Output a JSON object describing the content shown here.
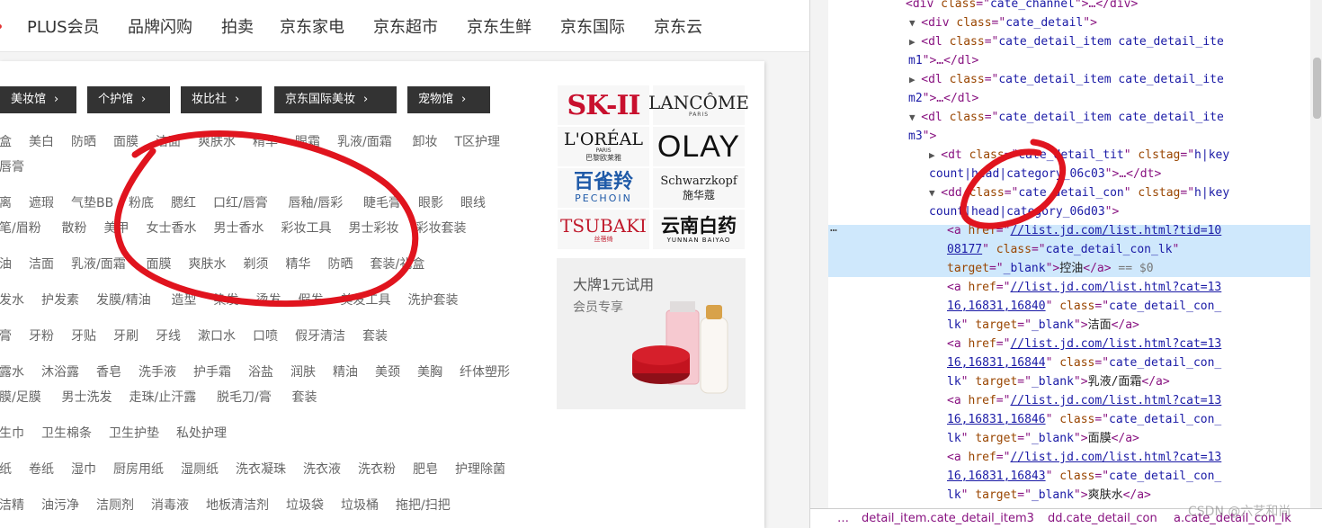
{
  "topnav": {
    "items": [
      "PLUS会员",
      "品牌闪购",
      "拍卖",
      "京东家电",
      "京东超市",
      "京东生鲜",
      "京东国际",
      "京东云"
    ]
  },
  "channels": [
    "美妆馆",
    "个护馆",
    "妆比社",
    "京东国际美妆",
    "宠物馆"
  ],
  "categories": [
    [
      "盒",
      "美白",
      "防晒",
      "面膜",
      "洁面",
      "爽肤水",
      "精华",
      "眼霜",
      "乳液/面霜",
      "卸妆",
      "T区护理"
    ],
    [
      "唇膏"
    ],
    [
      "离",
      "遮瑕",
      "气垫BB",
      "粉底",
      "腮红",
      "口红/唇膏",
      "唇釉/唇彩",
      "睫毛膏",
      "眼影",
      "眼线"
    ],
    [
      "笔/眉粉",
      "散粉",
      "美甲",
      "女士香水",
      "男士香水",
      "彩妆工具",
      "男士彩妆",
      "彩妆套装"
    ],
    [
      "油",
      "洁面",
      "乳液/面霜",
      "面膜",
      "爽肤水",
      "剃须",
      "精华",
      "防晒",
      "套装/礼盒"
    ],
    [
      "发水",
      "护发素",
      "发膜/精油",
      "造型",
      "染发",
      "烫发",
      "假发",
      "美发工具",
      "洗护套装"
    ],
    [
      "膏",
      "牙粉",
      "牙贴",
      "牙刷",
      "牙线",
      "漱口水",
      "口喷",
      "假牙清洁",
      "套装"
    ],
    [
      "露水",
      "沐浴露",
      "香皂",
      "洗手液",
      "护手霜",
      "浴盐",
      "润肤",
      "精油",
      "美颈",
      "美胸",
      "纤体塑形"
    ],
    [
      "膜/足膜",
      "男士洗发",
      "走珠/止汗露",
      "脱毛刀/膏",
      "套装"
    ],
    [
      "生巾",
      "卫生棉条",
      "卫生护垫",
      "私处护理"
    ],
    [
      "纸",
      "卷纸",
      "湿巾",
      "厨房用纸",
      "湿厕纸",
      "洗衣凝珠",
      "洗衣液",
      "洗衣粉",
      "肥皂",
      "护理除菌"
    ],
    [
      "洁精",
      "油污净",
      "洁厕剂",
      "消毒液",
      "地板清洁剂",
      "垃圾袋",
      "垃圾桶",
      "拖把/扫把"
    ]
  ],
  "brands": {
    "skii": "SK-II",
    "lancome": "LANCÔME",
    "lancome_sub": "PARIS",
    "loreal": "L'ORÉAL",
    "loreal_sub": "PARIS",
    "loreal_cn": "巴黎欧莱雅",
    "olay": "OLAY",
    "pechoin_cn": "百雀羚",
    "pechoin": "PECHOIN",
    "schwarzkopf": "Schwarzkopf",
    "schwarzkopf_cn": "施华蔻",
    "tsubaki": "TSUBAKI",
    "tsubaki_cn": "丝蓓绮",
    "yunnan_cn": "云南白药",
    "yunnan": "YUNNAN BAIYAO"
  },
  "promo": {
    "title": "大牌1元试用",
    "subtitle": "会员专享"
  },
  "devtools": {
    "lines": [
      {
        "indent": 0,
        "parts": [
          [
            "tag",
            "<div "
          ],
          [
            "attr",
            "class"
          ],
          [
            "tag",
            "=\""
          ],
          [
            "val",
            "cate_channel"
          ],
          [
            "tag",
            "\">…</div>"
          ]
        ]
      },
      {
        "indent": 0,
        "tri": "▼",
        "parts": [
          [
            "tag",
            "<div "
          ],
          [
            "attr",
            "class"
          ],
          [
            "tag",
            "=\""
          ],
          [
            "val",
            "cate_detail"
          ],
          [
            "tag",
            "\">"
          ]
        ]
      },
      {
        "indent": 1,
        "tri": "▶",
        "parts": [
          [
            "tag",
            "<dl "
          ],
          [
            "attr",
            "class"
          ],
          [
            "tag",
            "=\""
          ],
          [
            "val",
            "cate_detail_item cate_detail_ite"
          ]
        ]
      },
      {
        "indent": 1,
        "parts": [
          [
            "val",
            "m1"
          ],
          [
            "tag",
            "\">…</dl>"
          ]
        ]
      },
      {
        "indent": 1,
        "tri": "▶",
        "parts": [
          [
            "tag",
            "<dl "
          ],
          [
            "attr",
            "class"
          ],
          [
            "tag",
            "=\""
          ],
          [
            "val",
            "cate_detail_item cate_detail_ite"
          ]
        ]
      },
      {
        "indent": 1,
        "parts": [
          [
            "val",
            "m2"
          ],
          [
            "tag",
            "\">…</dl>"
          ]
        ]
      },
      {
        "indent": 1,
        "tri": "▼",
        "parts": [
          [
            "tag",
            "<dl "
          ],
          [
            "attr",
            "class"
          ],
          [
            "tag",
            "=\""
          ],
          [
            "val",
            "cate_detail_item cate_detail_ite"
          ]
        ]
      },
      {
        "indent": 1,
        "parts": [
          [
            "val",
            "m3"
          ],
          [
            "tag",
            "\">"
          ]
        ]
      },
      {
        "indent": 2,
        "tri": "▶",
        "parts": [
          [
            "tag",
            "<dt "
          ],
          [
            "attr",
            "class"
          ],
          [
            "tag",
            "=\""
          ],
          [
            "val",
            "cate_detail_tit"
          ],
          [
            "tag",
            "\" "
          ],
          [
            "attr",
            "clstag"
          ],
          [
            "tag",
            "=\""
          ],
          [
            "val",
            "h|key"
          ]
        ]
      },
      {
        "indent": 2,
        "parts": [
          [
            "val",
            "count|head|category_06c03"
          ],
          [
            "tag",
            "\">…</dt>"
          ]
        ]
      },
      {
        "indent": 2,
        "tri": "▼",
        "parts": [
          [
            "tag",
            "<dd "
          ],
          [
            "attr",
            "class"
          ],
          [
            "tag",
            "=\""
          ],
          [
            "val",
            "cate_detail_con"
          ],
          [
            "tag",
            "\" "
          ],
          [
            "attr",
            "clstag"
          ],
          [
            "tag",
            "=\""
          ],
          [
            "val",
            "h|key"
          ]
        ]
      },
      {
        "indent": 2,
        "parts": [
          [
            "val",
            "count|head|category_06d03"
          ],
          [
            "tag",
            "\">"
          ]
        ]
      },
      {
        "indent": 3,
        "parts": [
          [
            "tag",
            "<a "
          ],
          [
            "attr",
            "href"
          ],
          [
            "tag",
            "=\""
          ],
          [
            "link",
            "//list.jd.com/list.html?tid=10"
          ]
        ]
      },
      {
        "indent": 3,
        "parts": [
          [
            "link",
            "08177"
          ],
          [
            "tag",
            "\" "
          ],
          [
            "attr",
            "class"
          ],
          [
            "tag",
            "=\""
          ],
          [
            "val",
            "cate_detail_con_lk"
          ],
          [
            "tag",
            "\""
          ]
        ]
      },
      {
        "indent": 3,
        "parts": [
          [
            "attr",
            "target"
          ],
          [
            "tag",
            "=\""
          ],
          [
            "val",
            "_blank"
          ],
          [
            "tag",
            "\">"
          ],
          [
            "txt",
            "控油"
          ],
          [
            "tag",
            "</a>"
          ],
          [
            "grey",
            " == $0"
          ]
        ]
      },
      {
        "indent": 3,
        "parts": [
          [
            "tag",
            "<a "
          ],
          [
            "attr",
            "href"
          ],
          [
            "tag",
            "=\""
          ],
          [
            "link",
            "//list.jd.com/list.html?cat=13"
          ]
        ]
      },
      {
        "indent": 3,
        "parts": [
          [
            "link",
            "16,16831,16840"
          ],
          [
            "tag",
            "\" "
          ],
          [
            "attr",
            "class"
          ],
          [
            "tag",
            "=\""
          ],
          [
            "val",
            "cate_detail_con_"
          ]
        ]
      },
      {
        "indent": 3,
        "parts": [
          [
            "val",
            "lk"
          ],
          [
            "tag",
            "\" "
          ],
          [
            "attr",
            "target"
          ],
          [
            "tag",
            "=\""
          ],
          [
            "val",
            "_blank"
          ],
          [
            "tag",
            "\">"
          ],
          [
            "txt",
            "洁面"
          ],
          [
            "tag",
            "</a>"
          ]
        ]
      },
      {
        "indent": 3,
        "parts": [
          [
            "tag",
            "<a "
          ],
          [
            "attr",
            "href"
          ],
          [
            "tag",
            "=\""
          ],
          [
            "link",
            "//list.jd.com/list.html?cat=13"
          ]
        ]
      },
      {
        "indent": 3,
        "parts": [
          [
            "link",
            "16,16831,16844"
          ],
          [
            "tag",
            "\" "
          ],
          [
            "attr",
            "class"
          ],
          [
            "tag",
            "=\""
          ],
          [
            "val",
            "cate_detail_con_"
          ]
        ]
      },
      {
        "indent": 3,
        "parts": [
          [
            "val",
            "lk"
          ],
          [
            "tag",
            "\" "
          ],
          [
            "attr",
            "target"
          ],
          [
            "tag",
            "=\""
          ],
          [
            "val",
            "_blank"
          ],
          [
            "tag",
            "\">"
          ],
          [
            "txt",
            "乳液/面霜"
          ],
          [
            "tag",
            "</a>"
          ]
        ]
      },
      {
        "indent": 3,
        "parts": [
          [
            "tag",
            "<a "
          ],
          [
            "attr",
            "href"
          ],
          [
            "tag",
            "=\""
          ],
          [
            "link",
            "//list.jd.com/list.html?cat=13"
          ]
        ]
      },
      {
        "indent": 3,
        "parts": [
          [
            "link",
            "16,16831,16846"
          ],
          [
            "tag",
            "\" "
          ],
          [
            "attr",
            "class"
          ],
          [
            "tag",
            "=\""
          ],
          [
            "val",
            "cate_detail_con_"
          ]
        ]
      },
      {
        "indent": 3,
        "parts": [
          [
            "val",
            "lk"
          ],
          [
            "tag",
            "\" "
          ],
          [
            "attr",
            "target"
          ],
          [
            "tag",
            "=\""
          ],
          [
            "val",
            "_blank"
          ],
          [
            "tag",
            "\">"
          ],
          [
            "txt",
            "面膜"
          ],
          [
            "tag",
            "</a>"
          ]
        ]
      },
      {
        "indent": 3,
        "parts": [
          [
            "tag",
            "<a "
          ],
          [
            "attr",
            "href"
          ],
          [
            "tag",
            "=\""
          ],
          [
            "link",
            "//list.jd.com/list.html?cat=13"
          ]
        ]
      },
      {
        "indent": 3,
        "parts": [
          [
            "link",
            "16,16831,16843"
          ],
          [
            "tag",
            "\" "
          ],
          [
            "attr",
            "class"
          ],
          [
            "tag",
            "=\""
          ],
          [
            "val",
            "cate_detail_con_"
          ]
        ]
      },
      {
        "indent": 3,
        "parts": [
          [
            "val",
            "lk"
          ],
          [
            "tag",
            "\" "
          ],
          [
            "attr",
            "target"
          ],
          [
            "tag",
            "=\""
          ],
          [
            "val",
            "_blank"
          ],
          [
            "tag",
            "\">"
          ],
          [
            "txt",
            "爽肤水"
          ],
          [
            "tag",
            "</a>"
          ]
        ]
      }
    ],
    "selected_dots": "…",
    "breadcrumbs": [
      "…",
      "detail_item.cate_detail_item3",
      "dd.cate_detail_con",
      "a.cate_detail_con_lk"
    ],
    "watermark": "CSDN @六艺和尚"
  },
  "colors": {
    "jd_red": "#e33333",
    "annotation_red": "#e0141e",
    "selection": "#cfe8fc"
  }
}
